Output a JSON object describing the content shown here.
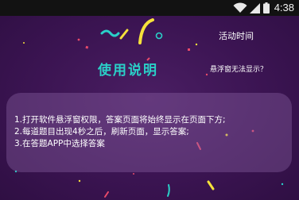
{
  "status_bar": {
    "time": "4:38",
    "icons": [
      "wifi-icon",
      "cell-signal-icon",
      "battery-icon"
    ]
  },
  "header": {
    "activity_time_label": "活动时间"
  },
  "main": {
    "title": "使用说明",
    "float_issue_label": "悬浮窗无法显示？",
    "instructions": [
      "1.打开软件悬浮窗权限，答案页面将始终显示在页面下方;",
      "2.每道题目出现4秒之后，刷新页面，显示答案;",
      "3.在答题APP中选择答案"
    ]
  },
  "colors": {
    "background": "#3d1554",
    "title": "#2ad0c8",
    "card": "#7a5a92",
    "status_bar": "#121212"
  }
}
